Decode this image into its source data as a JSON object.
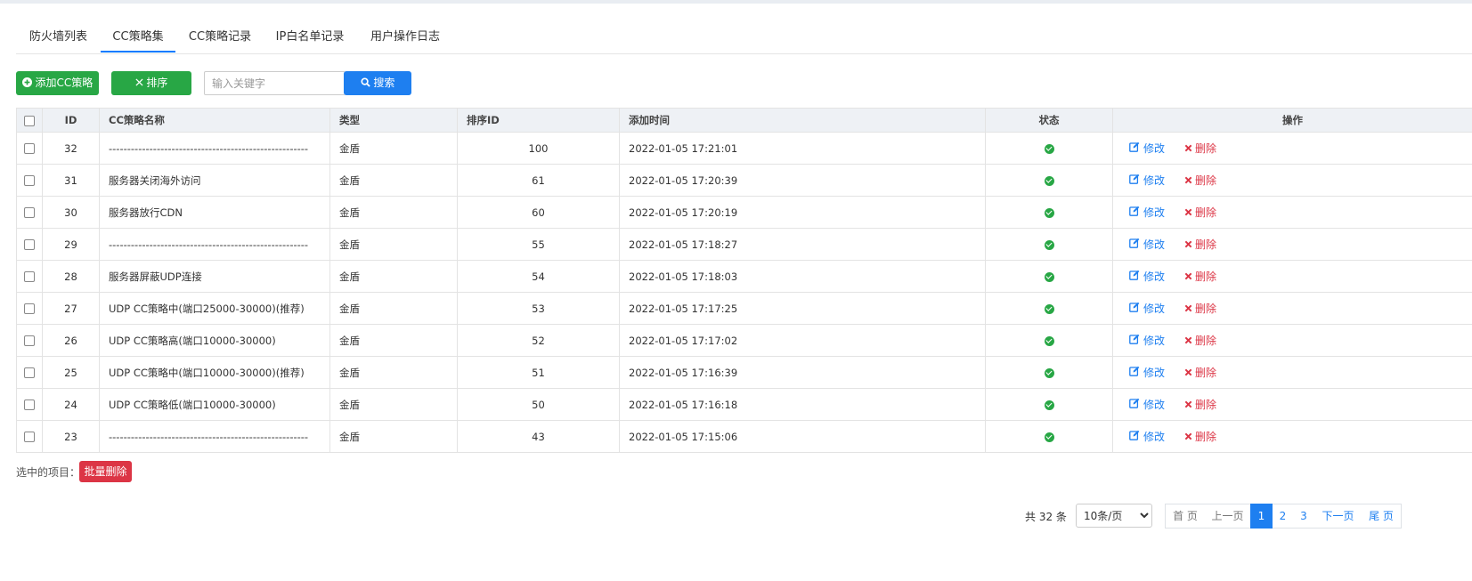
{
  "tabs": [
    {
      "label": "防火墙列表",
      "active": false
    },
    {
      "label": "CC策略集",
      "active": true
    },
    {
      "label": "CC策略记录",
      "active": false
    },
    {
      "label": "IP白名单记录",
      "active": false
    },
    {
      "label": "用户操作日志",
      "active": false
    }
  ],
  "toolbar": {
    "add_label": "添加CC策略",
    "sort_label": "排序",
    "search_placeholder": "输入关键字",
    "search_label": "搜索"
  },
  "table": {
    "columns": [
      "ID",
      "CC策略名称",
      "类型",
      "排序ID",
      "添加时间",
      "状态",
      "操作"
    ],
    "rows": [
      {
        "id": "32",
        "name": "------------------------------------------------------",
        "type": "金盾",
        "sort": "100",
        "time": "2022-01-05 17:21:01"
      },
      {
        "id": "31",
        "name": "服务器关闭海外访问",
        "type": "金盾",
        "sort": "61",
        "time": "2022-01-05 17:20:39"
      },
      {
        "id": "30",
        "name": "服务器放行CDN",
        "type": "金盾",
        "sort": "60",
        "time": "2022-01-05 17:20:19"
      },
      {
        "id": "29",
        "name": "------------------------------------------------------",
        "type": "金盾",
        "sort": "55",
        "time": "2022-01-05 17:18:27"
      },
      {
        "id": "28",
        "name": "服务器屏蔽UDP连接",
        "type": "金盾",
        "sort": "54",
        "time": "2022-01-05 17:18:03"
      },
      {
        "id": "27",
        "name": "UDP CC策略中(端口25000-30000)(推荐)",
        "type": "金盾",
        "sort": "53",
        "time": "2022-01-05 17:17:25"
      },
      {
        "id": "26",
        "name": "UDP CC策略高(端口10000-30000)",
        "type": "金盾",
        "sort": "52",
        "time": "2022-01-05 17:17:02"
      },
      {
        "id": "25",
        "name": "UDP CC策略中(端口10000-30000)(推荐)",
        "type": "金盾",
        "sort": "51",
        "time": "2022-01-05 17:16:39"
      },
      {
        "id": "24",
        "name": "UDP CC策略低(端口10000-30000)",
        "type": "金盾",
        "sort": "50",
        "time": "2022-01-05 17:16:18"
      },
      {
        "id": "23",
        "name": "------------------------------------------------------",
        "type": "金盾",
        "sort": "43",
        "time": "2022-01-05 17:15:06"
      }
    ],
    "edit_label": "修改",
    "delete_label": "删除"
  },
  "batch": {
    "label": "选中的项目：",
    "delete_label": "批量删除"
  },
  "pagination": {
    "total": "共 32 条",
    "page_size": "10条/页",
    "first": "首 页",
    "prev": "上一页",
    "pages": [
      "1",
      "2",
      "3"
    ],
    "current": "1",
    "next": "下一页",
    "last": "尾 页"
  },
  "colors": {
    "primary": "#1e7ff0",
    "success": "#28a745",
    "danger": "#dc3545",
    "header_bg": "#eef1f5"
  }
}
